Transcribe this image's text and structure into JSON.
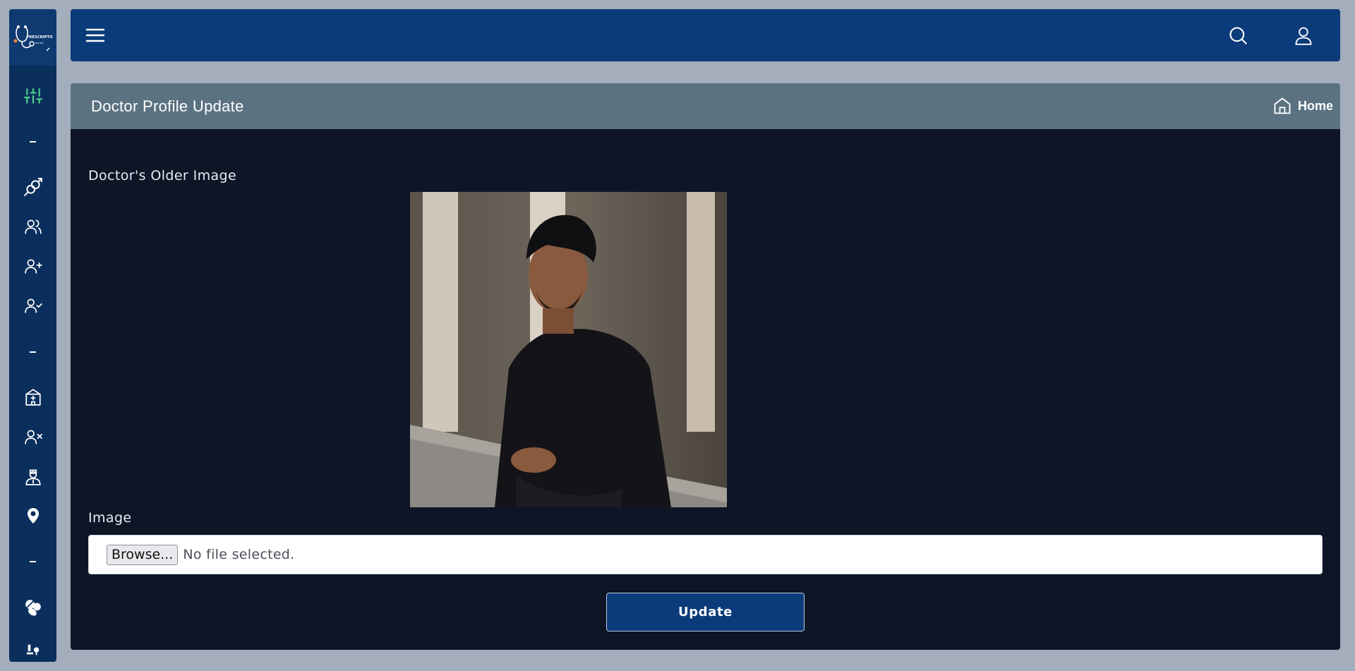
{
  "app": {
    "logo_text": "PRESCRIPTO",
    "logo_subtext": "VISITOR"
  },
  "sidebar": {
    "items": [
      {
        "icon": "sliders-icon",
        "color": "#4fd28a"
      },
      {
        "icon": "gender-icon"
      },
      {
        "icon": "users-icon"
      },
      {
        "icon": "user-plus-icon"
      },
      {
        "icon": "user-check-icon"
      },
      {
        "icon": "hospital-icon"
      },
      {
        "icon": "user-x-icon"
      },
      {
        "icon": "doctor-icon"
      },
      {
        "icon": "location-pin-icon"
      },
      {
        "icon": "pills-icon"
      },
      {
        "icon": "medical-icon"
      }
    ]
  },
  "navbar": {
    "menu_icon": "hamburger-icon",
    "search_icon": "search-icon",
    "user_icon": "user-icon"
  },
  "page_header": {
    "title": "Doctor Profile Update",
    "breadcrumb_label": "Home",
    "breadcrumb_icon": "home-icon"
  },
  "form": {
    "older_image_label": "Doctor's Older Image",
    "image_label": "Image",
    "browse_label": "Browse...",
    "file_status": "No file selected.",
    "submit_label": "Update"
  },
  "colors": {
    "background": "#a3adbb",
    "sidebar": "#0b2f5c",
    "navbar": "#0b3b7a",
    "header": "#5b7281",
    "card": "#0d1526",
    "accent_green": "#4fd28a"
  }
}
